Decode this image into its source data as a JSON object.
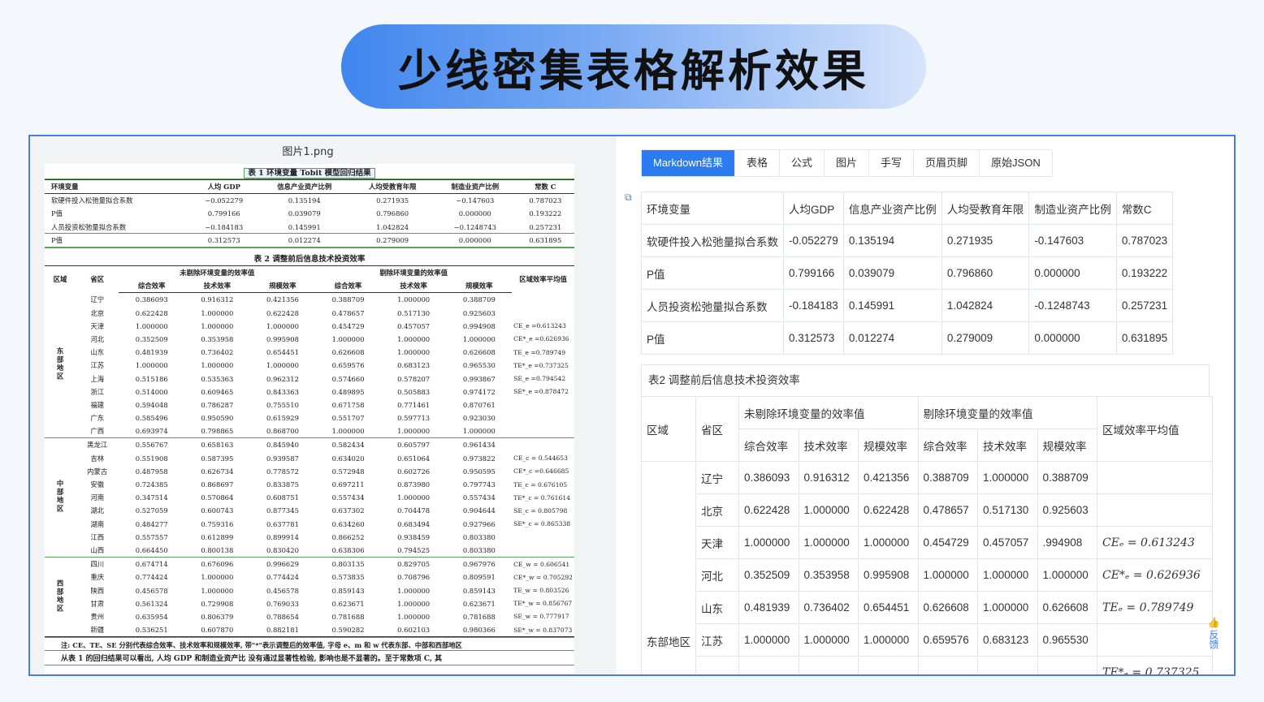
{
  "banner": {
    "title": "少线密集表格解析效果"
  },
  "left": {
    "file_name": "图片1.png",
    "table1_caption": "表 1 环境变量 Tobit 模型回归结果",
    "table1_header": [
      "环境变量",
      "人均 GDP",
      "信息产业资产比例",
      "人均受教育年限",
      "制造业资产比例",
      "常数 C"
    ],
    "table1_rows": [
      [
        "软硬件投入松弛量拟合系数",
        "−0.052279",
        "0.135194",
        "0.271935",
        "−0.147603",
        "0.787023"
      ],
      [
        "P值",
        "0.799166",
        "0.039079",
        "0.796860",
        "0.000000",
        "0.193222"
      ],
      [
        "人员投资松弛量拟合系数",
        "−0.184183",
        "0.145991",
        "1.042824",
        "−0.1248743",
        "0.257231"
      ],
      [
        "P值",
        "0.312573",
        "0.012274",
        "0.279009",
        "0.000000",
        "0.631895"
      ]
    ],
    "table2_caption": "表 2 调整前后信息技术投资效率",
    "table2_head": {
      "region": "区域",
      "province": "省区",
      "group1": "未剔除环境变量的效率值",
      "group2": "剔除环境变量的效率值",
      "avg": "区域效率平均值",
      "sub": [
        "综合效率",
        "技术效率",
        "规模效率",
        "综合效率",
        "技术效率",
        "规模效率"
      ]
    },
    "table2_groups": [
      {
        "region": "东部地区",
        "rows": [
          [
            "辽宁",
            "0.386093",
            "0.916312",
            "0.421356",
            "0.388709",
            "1.000000",
            "0.388709",
            ""
          ],
          [
            "北京",
            "0.622428",
            "1.000000",
            "0.622428",
            "0.478657",
            "0.517130",
            "0.925603",
            ""
          ],
          [
            "天津",
            "1.000000",
            "1.000000",
            "1.000000",
            "0.454729",
            "0.457057",
            "0.994908",
            "CE_e =0.613243"
          ],
          [
            "河北",
            "0.352509",
            "0.353958",
            "0.995908",
            "1.000000",
            "1.000000",
            "1.000000",
            "CE*_e =0.626936"
          ],
          [
            "山东",
            "0.481939",
            "0.736402",
            "0.654451",
            "0.626608",
            "1.000000",
            "0.626608",
            "TE_e =0.789749"
          ],
          [
            "江苏",
            "1.000000",
            "1.000000",
            "1.000000",
            "0.659576",
            "0.683123",
            "0.965530",
            "TE*_e =0.737325"
          ],
          [
            "上海",
            "0.515186",
            "0.535363",
            "0.962312",
            "0.574660",
            "0.578207",
            "0.993867",
            "SE_e =0.794542"
          ],
          [
            "浙江",
            "0.514000",
            "0.609465",
            "0.843363",
            "0.489895",
            "0.505883",
            "0.974172",
            "SE*_e =0.878472"
          ],
          [
            "福建",
            "0.594048",
            "0.786287",
            "0.755510",
            "0.671758",
            "0.771461",
            "0.870761",
            ""
          ],
          [
            "广东",
            "0.585496",
            "0.950590",
            "0.615929",
            "0.551707",
            "0.597713",
            "0.923030",
            ""
          ],
          [
            "广西",
            "0.693974",
            "0.798865",
            "0.868700",
            "1.000000",
            "1.000000",
            "1.000000",
            ""
          ]
        ]
      },
      {
        "region": "中部地区",
        "rows": [
          [
            "黑龙江",
            "0.556767",
            "0.658163",
            "0.845940",
            "0.582434",
            "0.605797",
            "0.961434",
            ""
          ],
          [
            "吉林",
            "0.551908",
            "0.587395",
            "0.939587",
            "0.634020",
            "0.651064",
            "0.973822",
            "CE_c = 0.544653"
          ],
          [
            "内蒙古",
            "0.487958",
            "0.626734",
            "0.778572",
            "0.572948",
            "0.602726",
            "0.950595",
            "CE*_c =0.646685"
          ],
          [
            "安徽",
            "0.724385",
            "0.868697",
            "0.833875",
            "0.697211",
            "0.873980",
            "0.797743",
            "TE_c = 0.676105"
          ],
          [
            "河南",
            "0.347514",
            "0.570864",
            "0.608751",
            "0.557434",
            "1.000000",
            "0.557434",
            "TE*_c = 0.761614"
          ],
          [
            "湖北",
            "0.527059",
            "0.600743",
            "0.877345",
            "0.637302",
            "0.704478",
            "0.904644",
            "SE_c = 0.805798"
          ],
          [
            "湖南",
            "0.484277",
            "0.759316",
            "0.637781",
            "0.634260",
            "0.683494",
            "0.927966",
            "SE*_c = 0.865338"
          ],
          [
            "江西",
            "0.557557",
            "0.612899",
            "0.899914",
            "0.866252",
            "0.938459",
            "0.803380",
            ""
          ],
          [
            "山西",
            "0.664450",
            "0.800138",
            "0.830420",
            "0.638306",
            "0.794525",
            "0.803380",
            ""
          ]
        ]
      },
      {
        "region": "西部地区",
        "rows": [
          [
            "四川",
            "0.674714",
            "0.676096",
            "0.996629",
            "0.803135",
            "0.829705",
            "0.967976",
            "CE_w = 0.606541"
          ],
          [
            "重庆",
            "0.774424",
            "1.000000",
            "0.774424",
            "0.573835",
            "0.708796",
            "0.809591",
            "CE*_w = 0.705292"
          ],
          [
            "陕西",
            "0.456578",
            "1.000000",
            "0.456578",
            "0.859143",
            "1.000000",
            "0.859143",
            "TE_w = 0.803526"
          ],
          [
            "甘肃",
            "0.561324",
            "0.729908",
            "0.769033",
            "0.623671",
            "1.000000",
            "0.623671",
            "TE*_w = 0.856767"
          ],
          [
            "贵州",
            "0.635954",
            "0.806379",
            "0.788654",
            "0.781688",
            "1.000000",
            "0.781688",
            "SE_w = 0.777917"
          ],
          [
            "新疆",
            "0.536251",
            "0.607870",
            "0.882181",
            "0.590282",
            "0.602103",
            "0.980366",
            "SE*_w = 0.837073"
          ]
        ]
      }
    ],
    "note": "注: CE、TE、SE 分别代表综合效率、技术效率和规模效率, 带\"*\"表示调整后的效率值, 字母 e、m 和 w 代表东部、中部和西部地区",
    "body_text": "从表 1 的回归结果可以看出, 人均 GDP 和制造业资产比    没有通过显著性检验, 影响也是不显著的。至于常数项 C, 其"
  },
  "right": {
    "tabs": [
      "Markdown结果",
      "表格",
      "公式",
      "图片",
      "手写",
      "页眉页脚",
      "原始JSON"
    ],
    "active_tab": 0,
    "table1_header": [
      "环境变量",
      "人均GDP",
      "信息产业资产比例",
      "人均受教育年限",
      "制造业资产比例",
      "常数C"
    ],
    "table1_rows": [
      [
        "软硬件投入松弛量拟合系数",
        "-0.052279",
        "0.135194",
        "0.271935",
        "-0.147603",
        "0.787023"
      ],
      [
        "P值",
        "0.799166",
        "0.039079",
        "0.796860",
        "0.000000",
        "0.193222"
      ],
      [
        "人员投资松弛量拟合系数",
        "-0.184183",
        "0.145991",
        "1.042824",
        "-0.1248743",
        "0.257231"
      ],
      [
        "P值",
        "0.312573",
        "0.012274",
        "0.279009",
        "0.000000",
        "0.631895"
      ]
    ],
    "table2_title": "表2 调整前后信息技术投资效率",
    "table2_head": {
      "region": "区域",
      "province": "省区",
      "group1": "未剔除环境变量的效率值",
      "group2": "剔除环境变量的效率值",
      "avg": "区域效率平均值",
      "sub": [
        "综合效率",
        "技术效率",
        "规模效率",
        "综合效率",
        "技术效率",
        "规模效率"
      ]
    },
    "table2_region": "东部地区",
    "table2_rows": [
      [
        "辽宁",
        "0.386093",
        "0.916312",
        "0.421356",
        "0.388709",
        "1.000000",
        "0.388709",
        ""
      ],
      [
        "北京",
        "0.622428",
        "1.000000",
        "0.622428",
        "0.478657",
        "0.517130",
        "0.925603",
        ""
      ],
      [
        "天津",
        "1.000000",
        "1.000000",
        "1.000000",
        "0.454729",
        "0.457057",
        ".994908",
        "CEₑ = 0.613243"
      ],
      [
        "河北",
        "0.352509",
        "0.353958",
        "0.995908",
        "1.000000",
        "1.000000",
        "1.000000",
        "CE*ₑ = 0.626936"
      ],
      [
        "山东",
        "0.481939",
        "0.736402",
        "0.654451",
        "0.626608",
        "1.000000",
        "0.626608",
        "TEₑ = 0.789749"
      ],
      [
        "江苏",
        "1.000000",
        "1.000000",
        "1.000000",
        "0.659576",
        "0.683123",
        "0.965530",
        ""
      ]
    ],
    "table2_overflow_formula": "TE*ₑ = 0.737325",
    "feedback": "反馈"
  }
}
